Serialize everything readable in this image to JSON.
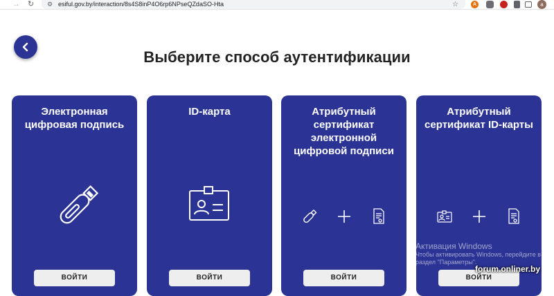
{
  "browser": {
    "url": "esiful.gov.by/interaction/8s4S8inP4O6rp6NPseQZdaSO-Hta",
    "profile_initial": "a"
  },
  "page": {
    "title": "Выберите способ аутентификации",
    "back_label": "‹"
  },
  "cards": [
    {
      "title_lines": [
        "Электронная",
        "цифровая подпись"
      ],
      "button": "ВОЙТИ",
      "icon": "usb-token-icon"
    },
    {
      "title_lines": [
        "ID-карта"
      ],
      "button": "ВОЙТИ",
      "icon": "id-card-icon"
    },
    {
      "title_lines": [
        "Атрибутный",
        "сертификат",
        "электронной",
        "цифровой подписи"
      ],
      "button": "ВОЙТИ",
      "icon": "usb-plus-certificate-icons"
    },
    {
      "title_lines": [
        "Атрибутный",
        "сертификат ID-карты"
      ],
      "button": "ВОЙТИ",
      "icon": "idcard-plus-certificate-icons"
    }
  ],
  "watermark": {
    "line1": "Активация Windows",
    "line2": "Чтобы активировать Windows, перейдите в",
    "line3": "раздел \"Параметры\"."
  },
  "brand": "forum.onliner.by",
  "colors": {
    "card_bg": "#2b3394",
    "button_bg": "#eeeeee"
  }
}
